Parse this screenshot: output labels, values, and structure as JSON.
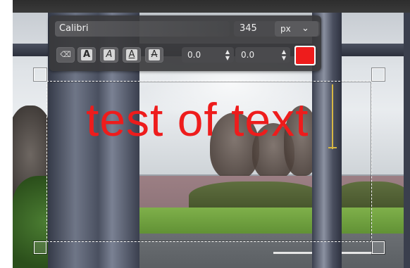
{
  "toolbar": {
    "font_name": "Calibri",
    "font_size": "345",
    "unit": "px",
    "style_buttons": {
      "clear_icon": "clear-format-icon",
      "bold": "A",
      "italic": "A",
      "underline": "A",
      "strikethrough": "A"
    },
    "baseline_offset": "0.0",
    "letter_spacing": "0.0",
    "text_color": "#ee1c1c"
  },
  "canvas": {
    "text_content": "test of text",
    "text_color": "#ee1c1c"
  },
  "icons": {
    "stepper": "up-down-stepper-icon",
    "chevron": "chevron-down-icon"
  }
}
